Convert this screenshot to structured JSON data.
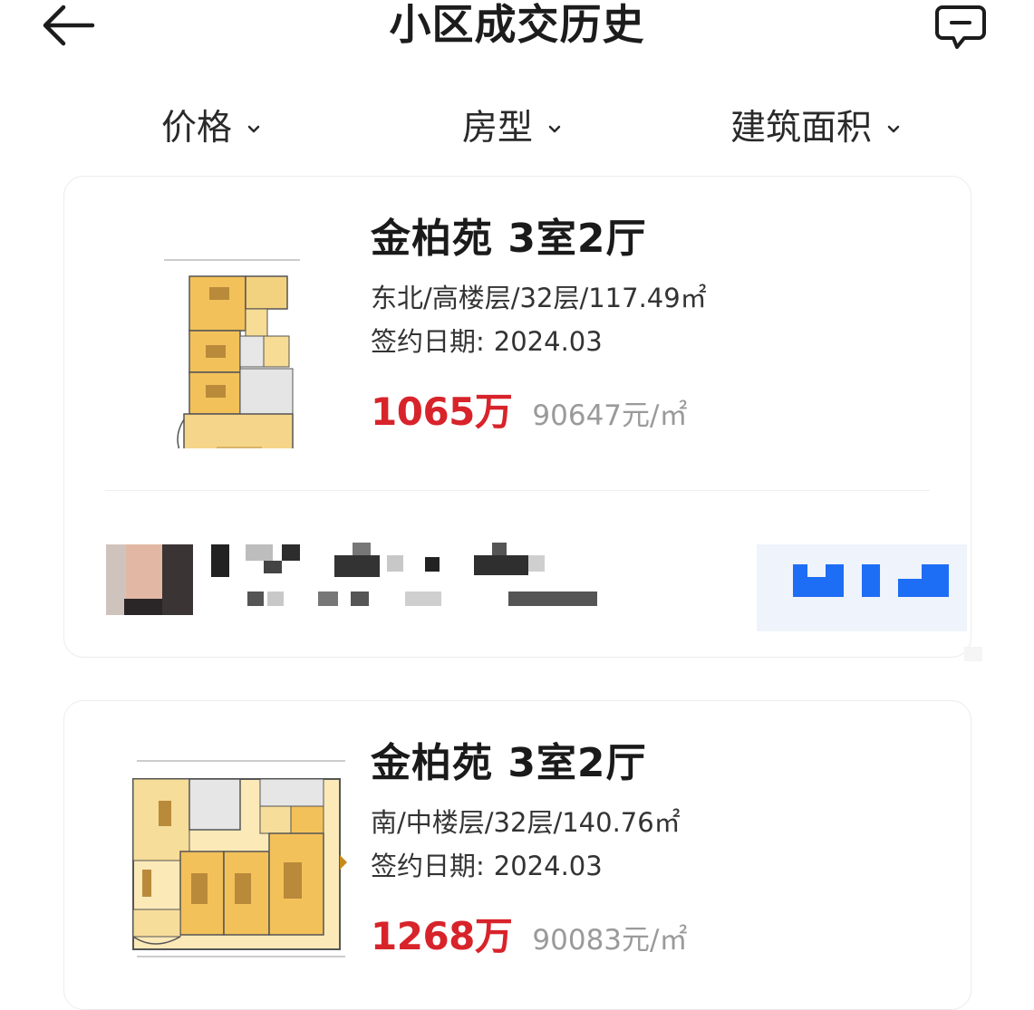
{
  "header": {
    "title": "小区成交历史",
    "back_icon": "arrow-left-icon",
    "action_icon": "feedback-message-icon"
  },
  "filters": [
    {
      "label": "价格"
    },
    {
      "label": "房型"
    },
    {
      "label": "建筑面积"
    }
  ],
  "listings": [
    {
      "title": "金柏苑 3室2厅",
      "specs": "东北/高楼层/32层/117.49㎡",
      "sign_date_label": "签约日期:",
      "sign_date": "2024.03",
      "total_price": "1065万",
      "unit_price": "90647元/㎡"
    },
    {
      "title": "金柏苑 3室2厅",
      "specs": "南/中楼层/32层/140.76㎡",
      "sign_date_label": "签约日期:",
      "sign_date": "2024.03",
      "total_price": "1268万",
      "unit_price": "90083元/㎡"
    }
  ],
  "colors": {
    "price_red": "#d8232a",
    "muted_gray": "#9a9a9a",
    "contact_blue": "#1e6df5"
  }
}
